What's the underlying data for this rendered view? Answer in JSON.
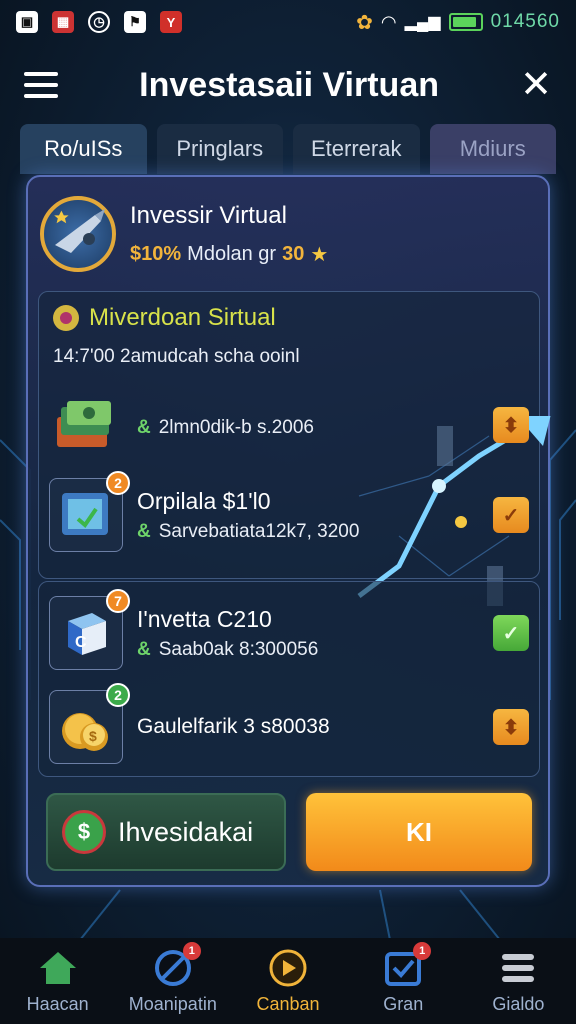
{
  "status_bar": {
    "time": "014560",
    "left_icons": [
      "photo-icon",
      "calendar-icon",
      "clock-icon",
      "flag-icon",
      "yelp-icon"
    ],
    "right_icons": [
      "pet-icon",
      "wifi-icon",
      "signal-icon",
      "battery-icon"
    ],
    "battery_level": 0.9
  },
  "header": {
    "title": "Investasaii Virtuan"
  },
  "tabs": [
    {
      "label": "Ro/uISs"
    },
    {
      "label": "Pringlars"
    },
    {
      "label": "Eterrerak"
    },
    {
      "label": "Mdiurs"
    }
  ],
  "profile": {
    "name": "Invessir Virtual",
    "stat_percent": "$10%",
    "stat_text": "Mdolan gr",
    "stat_value": "30",
    "star_icon": "star-icon"
  },
  "section": {
    "title": "Miverdoan Sirtual",
    "subtitle": "14:7'00 2amudcah scha ooinl"
  },
  "rows": [
    {
      "title": "",
      "sub_prefix": "&",
      "sub": "2lmn0dik-b s.2006",
      "action": "orange",
      "action_icon": "pin-icon",
      "thumb_icon": "cash-stack-icon"
    },
    {
      "title": "Orpilala $1'l0",
      "sub_prefix": "&",
      "sub": "Sarvebatiata12k7, 3200",
      "action": "orange",
      "action_icon": "check-icon",
      "thumb_icon": "tablet-chart-icon",
      "badge": "2"
    },
    {
      "title": "I'nvetta C210",
      "sub_prefix": "&",
      "sub": "Saab0ak 8:300056",
      "action": "green",
      "action_icon": "check-icon",
      "thumb_icon": "cube-c-icon",
      "badge": "7"
    },
    {
      "title": "",
      "sub_prefix": "",
      "sub": "Gaulelfarik 3 s80038",
      "action": "orange",
      "action_icon": "pin-icon",
      "thumb_icon": "gold-coins-icon",
      "badge": "2"
    }
  ],
  "buttons": {
    "invest_label": "Ihvesidakai",
    "ok_label": "KI"
  },
  "bottom_nav": [
    {
      "label": "Haacan",
      "icon": "home-icon",
      "badge": ""
    },
    {
      "label": "Moanipatin",
      "icon": "compass-icon",
      "badge": "1"
    },
    {
      "label": "Canban",
      "icon": "chat-icon",
      "badge": ""
    },
    {
      "label": "Gran",
      "icon": "checklist-icon",
      "badge": "1"
    },
    {
      "label": "Gialdo",
      "icon": "menu-icon",
      "badge": ""
    }
  ],
  "colors": {
    "accent_orange": "#f2b43c",
    "accent_green": "#6ed36a",
    "panel_border": "#5a6fb8",
    "section_title": "#d8e24a"
  }
}
